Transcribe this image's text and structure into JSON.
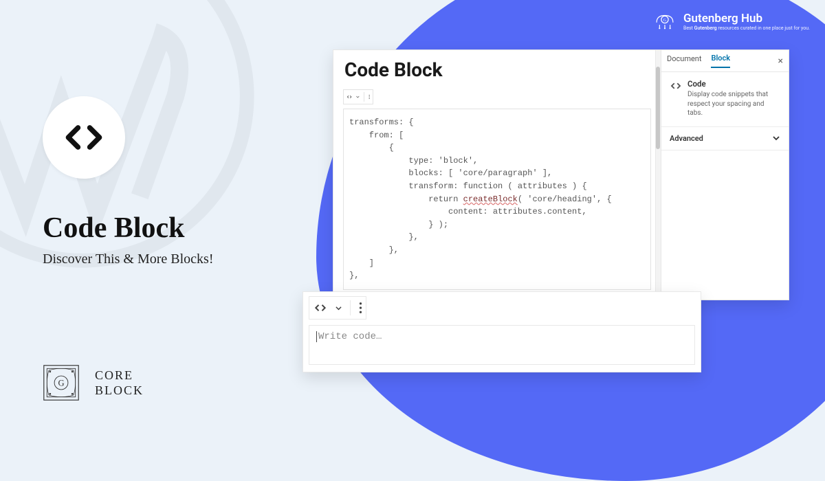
{
  "brand": {
    "name": "Gutenberg Hub",
    "tagline_prefix": "Best ",
    "tagline_bold": "Gutenberg",
    "tagline_suffix": " resources curated in one place just for you."
  },
  "hero": {
    "title": "Code Block",
    "subtitle": "Discover This & More Blocks!"
  },
  "footer": {
    "line1": "CORE",
    "line2": "BLOCK"
  },
  "editor": {
    "heading": "Code Block",
    "code_lines": [
      "transforms: {",
      "    from: [",
      "        {",
      "            type: 'block',",
      "            blocks: [ 'core/paragraph' ],",
      "            transform: function ( attributes ) {",
      "                return createBlock( 'core/heading', {",
      "                    content: attributes.content,",
      "                } );",
      "            },",
      "        },",
      "    ]",
      "},"
    ],
    "error_token": "createBlock"
  },
  "sidebar": {
    "tabs": [
      "Document",
      "Block"
    ],
    "active_tab": "Block",
    "block_name": "Code",
    "block_desc": "Display code snippets that respect your spacing and tabs.",
    "accordion": "Advanced"
  },
  "empty": {
    "placeholder": "Write code…"
  }
}
